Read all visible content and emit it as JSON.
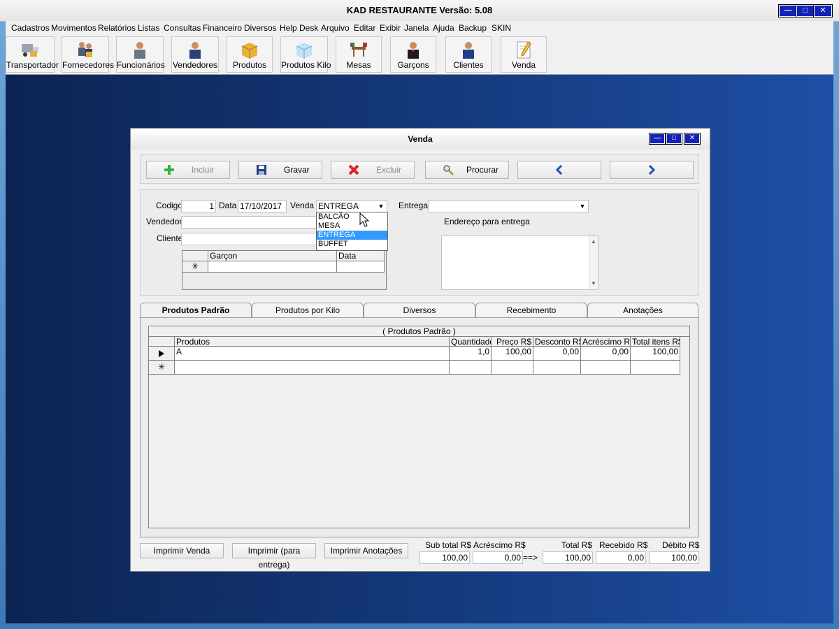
{
  "window": {
    "title": "KAD RESTAURANTE     Versão: 5.08"
  },
  "menu": [
    "Cadastros",
    "Movimentos",
    "Relatórios",
    "Listas",
    "Consultas",
    "Financeiro",
    "Diversos",
    "Help Desk",
    "Arquivo",
    "Editar",
    "Exibir",
    "Janela",
    "Ajuda",
    "Backup",
    "SKIN"
  ],
  "toolbar": [
    {
      "label": "Transportador",
      "icon": "truck-icon"
    },
    {
      "label": "Fornecedores",
      "icon": "suppliers-icon"
    },
    {
      "label": "Funcionários",
      "icon": "employee-icon"
    },
    {
      "label": "Vendedores",
      "icon": "seller-icon"
    },
    {
      "label": "Produtos",
      "icon": "box-icon"
    },
    {
      "label": "Produtos Kilo",
      "icon": "scale-box-icon"
    },
    {
      "label": "Mesas",
      "icon": "table-icon"
    },
    {
      "label": "Garçons",
      "icon": "waiter-icon"
    },
    {
      "label": "Clientes",
      "icon": "client-icon"
    },
    {
      "label": "Venda",
      "icon": "pencil-note-icon"
    }
  ],
  "child": {
    "title": "Venda",
    "actions": {
      "incluir": "Incluir",
      "gravar": "Gravar",
      "excluir": "Excluir",
      "procurar": "Procurar"
    },
    "form": {
      "codigo_label": "Codigo",
      "codigo": "1",
      "data_label": "Data",
      "data": "17/10/2017",
      "venda_label": "Venda",
      "venda": "ENTREGA",
      "entrega_label": "Entrega",
      "entrega": "",
      "vendedor_label": "Vendedor",
      "vendedor": "",
      "cliente_label": "Cliente",
      "cliente": "",
      "endereco_label": "Endereço para entrega",
      "venda_options": [
        "BALCÃO",
        "MESA",
        "ENTREGA",
        "BUFFET"
      ],
      "venda_selected": "ENTREGA"
    },
    "garcon_grid": {
      "columns": [
        "Garçon",
        "Data"
      ],
      "new_row_marker": "✳"
    },
    "tabs": [
      "Produtos Padrão",
      "Produtos por Kilo",
      "Diversos",
      "Recebimento",
      "Anotações"
    ],
    "active_tab": "Produtos Padrão",
    "products": {
      "caption": "( Produtos Padrão )",
      "columns": [
        "Produtos",
        "Quantidade",
        "Preço R$",
        "Desconto R$",
        "Acréscimo R$",
        "Total itens R$"
      ],
      "rows": [
        [
          "A",
          "1,0",
          "100,00",
          "0,00",
          "0,00",
          "100,00"
        ]
      ],
      "new_row_marker": "✳"
    },
    "bottom_buttons": [
      "Imprimir Venda",
      "Imprimir (para entrega)",
      "Imprimir Anotações"
    ],
    "totals": {
      "subtotal_label": "Sub total R$",
      "subtotal": "100,00",
      "acrescimo_label": "Acréscimo R$",
      "acrescimo": "0,00",
      "arrow": "==>",
      "total_label": "Total R$",
      "total": "100,00",
      "recebido_label": "Recebido R$",
      "recebido": "0,00",
      "debito_label": "Débito R$",
      "debito": "100,00"
    }
  }
}
